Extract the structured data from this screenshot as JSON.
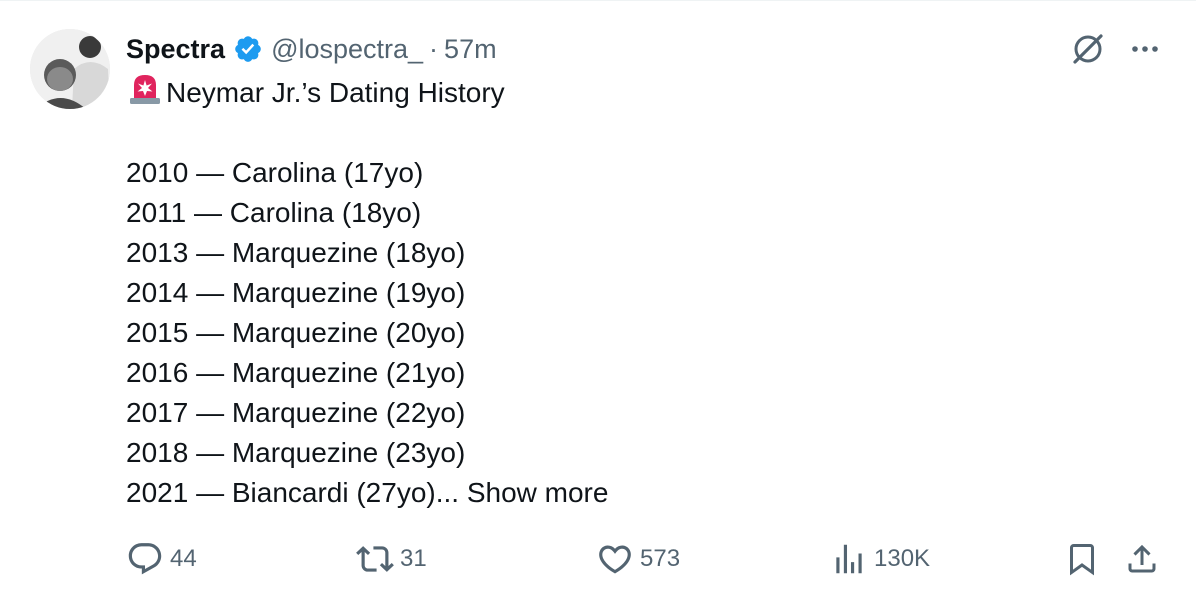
{
  "author": {
    "display_name": "Spectra",
    "handle": "@lospectra_",
    "separator": "·",
    "time": "57m"
  },
  "post": {
    "title": "Neymar Jr.’s Dating History",
    "title_emoji": "siren-icon",
    "entries": [
      "2010 — Carolina (17yo)",
      "2011 — Carolina (18yo)",
      "2013 — Marquezine (18yo)",
      "2014 — Marquezine (19yo)",
      "2015 — Marquezine (20yo)",
      "2016 — Marquezine (21yo)",
      "2017 — Marquezine (22yo)",
      "2018 — Marquezine (23yo)"
    ],
    "last_entry": "2021 — Biancardi (27yo)...",
    "show_more": "Show more"
  },
  "metrics": {
    "replies": "44",
    "reposts": "31",
    "likes": "573",
    "views": "130K"
  },
  "colors": {
    "text": "#0f1419",
    "secondary": "#536471",
    "verified": "#1d9bf0",
    "siren": "#e0245e"
  }
}
